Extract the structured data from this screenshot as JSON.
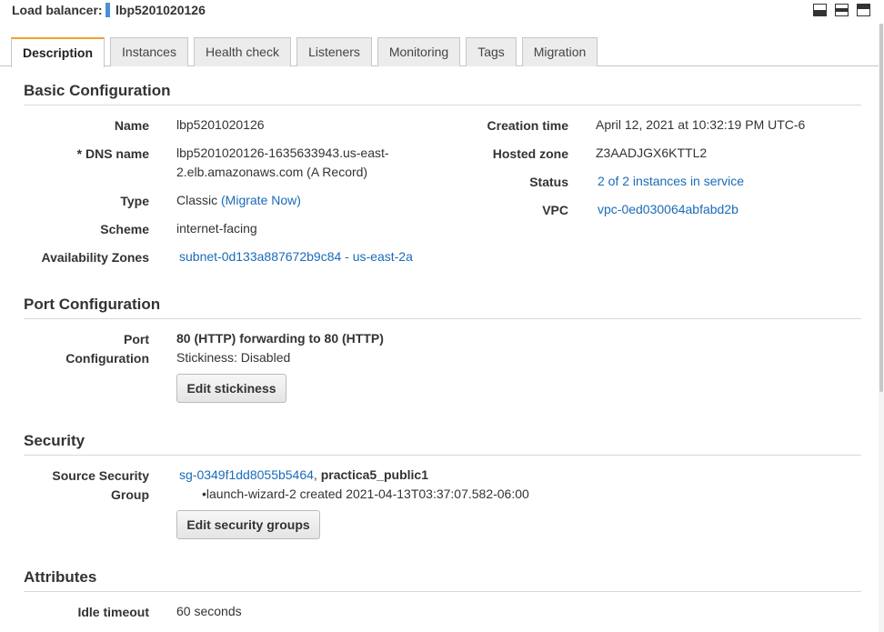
{
  "header": {
    "label": "Load balancer:",
    "name": "lbp5201020126"
  },
  "tabs": [
    {
      "label": "Description"
    },
    {
      "label": "Instances"
    },
    {
      "label": "Health check"
    },
    {
      "label": "Listeners"
    },
    {
      "label": "Monitoring"
    },
    {
      "label": "Tags"
    },
    {
      "label": "Migration"
    }
  ],
  "basic": {
    "title": "Basic Configuration",
    "name_label": "Name",
    "name_value": "lbp5201020126",
    "dns_label": "* DNS name",
    "dns_line1": "lbp5201020126-1635633943.us-east-",
    "dns_line2": "2.elb.amazonaws.com (A Record)",
    "type_label": "Type",
    "type_value": "Classic",
    "migrate_link": "(Migrate Now)",
    "scheme_label": "Scheme",
    "scheme_value": "internet-facing",
    "az_label": "Availability Zones",
    "az_value": "subnet-0d133a887672b9c84 - us-east-2a",
    "creation_label": "Creation time",
    "creation_value": "April 12, 2021 at 10:32:19 PM UTC-6",
    "hosted_label": "Hosted zone",
    "hosted_value": "Z3AADJGX6KTTL2",
    "status_label": "Status",
    "status_value": "2 of 2 instances in service",
    "vpc_label": "VPC",
    "vpc_value": "vpc-0ed030064abfabd2b"
  },
  "port": {
    "title": "Port Configuration",
    "label_line1": "Port",
    "label_line2": "Configuration",
    "forwarding": "80 (HTTP) forwarding to 80 (HTTP)",
    "stickiness": "Stickiness: Disabled",
    "edit_button": "Edit stickiness"
  },
  "security": {
    "title": "Security",
    "label_line1": "Source Security",
    "label_line2": "Group",
    "sg_link": "sg-0349f1dd8055b5464",
    "sg_separator": ",",
    "sg_name": "practica5_public1",
    "sg_detail": "launch-wizard-2 created 2021-04-13T03:37:07.582-06:00",
    "edit_button": "Edit security groups"
  },
  "attributes": {
    "title": "Attributes",
    "idle_label": "Idle timeout",
    "idle_value": "60 seconds"
  },
  "colors": {
    "link": "#1a6bb8",
    "active_tab_accent": "#f0a030",
    "marker": "#4a90d9"
  },
  "icons": {
    "window_buttons": [
      "panel-bottom-icon",
      "panel-middle-icon",
      "panel-top-icon"
    ]
  }
}
